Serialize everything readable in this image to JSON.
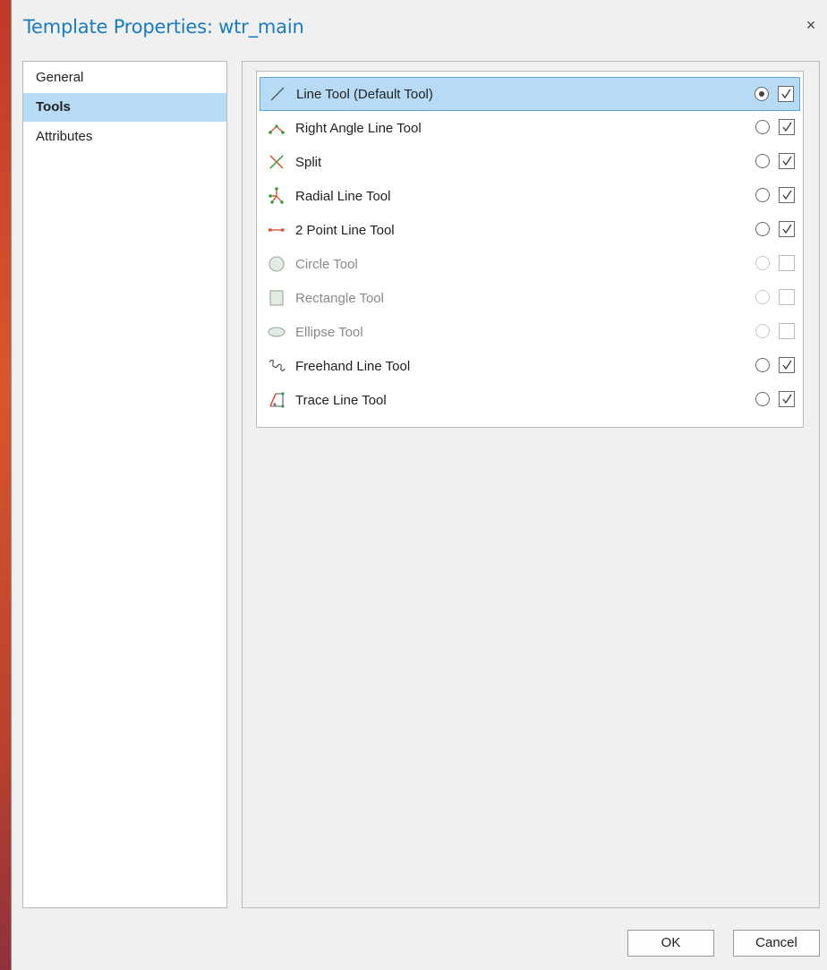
{
  "dialog": {
    "title": "Template Properties: wtr_main",
    "close_glyph": "×"
  },
  "sidebar": {
    "items": [
      {
        "label": "General",
        "active": false
      },
      {
        "label": "Tools",
        "active": true
      },
      {
        "label": "Attributes",
        "active": false
      }
    ]
  },
  "tools": [
    {
      "label": "Line Tool  (Default Tool)",
      "icon": "line-icon",
      "default": true,
      "checked": true,
      "enabled": true,
      "selected": true
    },
    {
      "label": "Right Angle Line Tool",
      "icon": "right-angle-line-icon",
      "default": false,
      "checked": true,
      "enabled": true,
      "selected": false
    },
    {
      "label": "Split",
      "icon": "split-icon",
      "default": false,
      "checked": true,
      "enabled": true,
      "selected": false
    },
    {
      "label": "Radial Line Tool",
      "icon": "radial-line-icon",
      "default": false,
      "checked": true,
      "enabled": true,
      "selected": false
    },
    {
      "label": "2 Point Line Tool",
      "icon": "two-point-line-icon",
      "default": false,
      "checked": true,
      "enabled": true,
      "selected": false
    },
    {
      "label": "Circle Tool",
      "icon": "circle-icon",
      "default": false,
      "checked": false,
      "enabled": false,
      "selected": false
    },
    {
      "label": "Rectangle Tool",
      "icon": "rectangle-icon",
      "default": false,
      "checked": false,
      "enabled": false,
      "selected": false
    },
    {
      "label": "Ellipse Tool",
      "icon": "ellipse-icon",
      "default": false,
      "checked": false,
      "enabled": false,
      "selected": false
    },
    {
      "label": "Freehand Line Tool",
      "icon": "freehand-line-icon",
      "default": false,
      "checked": true,
      "enabled": true,
      "selected": false
    },
    {
      "label": "Trace Line Tool",
      "icon": "trace-line-icon",
      "default": false,
      "checked": true,
      "enabled": true,
      "selected": false
    }
  ],
  "buttons": {
    "ok": "OK",
    "cancel": "Cancel"
  },
  "colors": {
    "title": "#1a7bc0",
    "selection": "#b7dbf5",
    "selection_border": "#5aa6de"
  }
}
